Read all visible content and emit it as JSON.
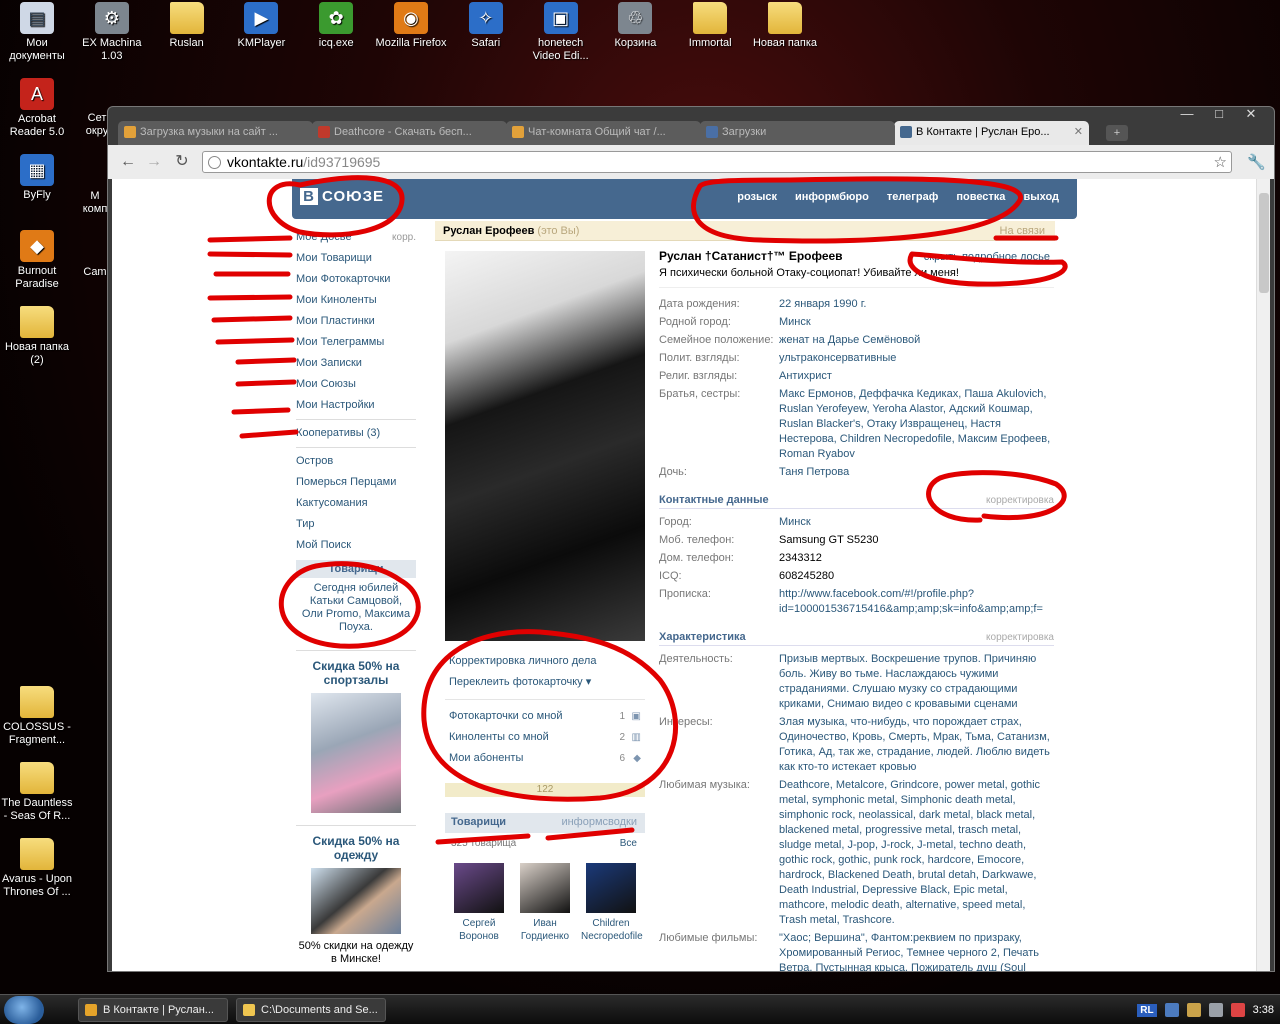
{
  "desktop": {
    "icons_top": [
      {
        "label": "Мои документы",
        "glyph": "▤",
        "kind": "g-doc"
      },
      {
        "label": "EX Machina 1.03",
        "glyph": "⚙",
        "kind": "g-gray"
      },
      {
        "label": "Ruslan",
        "glyph": "",
        "kind": "g-folder"
      },
      {
        "label": "KMPlayer",
        "glyph": "▶",
        "kind": "g-blue"
      },
      {
        "label": "icq.exe",
        "glyph": "✿",
        "kind": "g-green"
      },
      {
        "label": "Mozilla Firefox",
        "glyph": "◉",
        "kind": "g-orange"
      },
      {
        "label": "Safari",
        "glyph": "✧",
        "kind": "g-blue"
      },
      {
        "label": "honetech Video Edi...",
        "glyph": "▣",
        "kind": "g-blue"
      },
      {
        "label": "Корзина",
        "glyph": "♲",
        "kind": "g-gray"
      },
      {
        "label": "Immortal",
        "glyph": "",
        "kind": "g-folder"
      },
      {
        "label": "Новая папка",
        "glyph": "",
        "kind": "g-folder"
      }
    ],
    "icons_left": [
      {
        "label": "Acrobat Reader 5.0",
        "glyph": "A",
        "kind": "g-red"
      },
      {
        "label": "ByFly",
        "glyph": "▦",
        "kind": "g-blue"
      },
      {
        "label": "Burnout Paradise",
        "glyph": "◆",
        "kind": "g-orange"
      },
      {
        "label": "Новая папка (2)",
        "glyph": "",
        "kind": "g-folder"
      },
      {
        "label": "COLOSSUS - Fragment...",
        "glyph": "",
        "kind": "g-folder"
      },
      {
        "label": "The Dauntless - Seas Of R...",
        "glyph": "",
        "kind": "g-folder"
      },
      {
        "label": "Avarus - Upon Thrones Of ...",
        "glyph": "",
        "kind": "g-folder"
      }
    ],
    "partial_labels": [
      "Сет окру",
      "М комп",
      "Cam"
    ]
  },
  "browser": {
    "tabs": [
      {
        "title": "Загрузка музыки на сайт ...",
        "color": "#e2a13a"
      },
      {
        "title": "Deathcore - Скачать бесп...",
        "color": "#c0392b"
      },
      {
        "title": "Чат-комната Общий чат /...",
        "color": "#e2a13a"
      },
      {
        "title": "Загрузки",
        "color": "#4a6fa5"
      },
      {
        "title": "В Контакте | Руслан Еро...",
        "color": "#45688e"
      }
    ],
    "url_host": "vkontakte.ru",
    "url_path": "/id93719695",
    "controls": {
      "min": "—",
      "max": "□",
      "close": "✕"
    }
  },
  "vk": {
    "logo_b": "В",
    "logo_text": "СОЮЗЕ",
    "nav": [
      "розыск",
      "информбюро",
      "телеграф",
      "повестка",
      "выход"
    ],
    "menu": [
      "Моё Досье",
      "Мои Товарищи",
      "Мои Фотокарточки",
      "Мои Киноленты",
      "Мои Пластинки",
      "Мои Телеграммы",
      "Мои Записки",
      "Мои Союзы",
      "Мои Настройки"
    ],
    "menu_edit": "корр.",
    "coops": "Кооперативы (3)",
    "menu2": [
      "Остров",
      "Померься Перцами",
      "Кактусомания",
      "Тир",
      "Мой Поиск"
    ],
    "friends_box_title": "Товарищи",
    "friends_box_text": "Сегодня юбилей Катьки Самцовой, Оли Promo, Максима Поуха.",
    "ad1_title": "Скидка 50% на спортзалы",
    "ad2_title": "Скидка 50% на одежду",
    "ad2_caption": "50% скидки на одежду в Минске!",
    "head_name": "Руслан Ерофеев",
    "head_me": "(это Вы)",
    "head_online": "На связи",
    "profile_name": "Руслан †Сатанист†™ Ерофеев",
    "hide_link": "скрыть подробное досье",
    "status": "Я психически больной Отаку-социопат! Убивайте ли меня!",
    "basic": [
      {
        "k": "Дата рождения:",
        "v": "22 января 1990 г."
      },
      {
        "k": "Родной город:",
        "v": "Минск"
      },
      {
        "k": "Семейное положение:",
        "v": "женат на Дарье Семёновой"
      },
      {
        "k": "Полит. взгляды:",
        "v": "ультраконсервативные"
      },
      {
        "k": "Религ. взгляды:",
        "v": "Антихрист"
      },
      {
        "k": "Братья, сестры:",
        "v": "Макс Ермонов, Деффачка Кедиках, Паша Akulovich, Ruslan Yerofeyew, Yeroha Alastor, Адский Кошмар, Ruslan Blacker's, Отаку Извращенец, Настя Нестерова, Children Necropedofile, Максим Ерофеев, Roman Ryabov"
      },
      {
        "k": "Дочь:",
        "v": "Таня Петрова"
      }
    ],
    "contacts_title": "Контактные данные",
    "edit_label": "корректировка",
    "contacts": [
      {
        "k": "Город:",
        "v": "Минск"
      },
      {
        "k": "Моб. телефон:",
        "v": "Samsung GT S5230"
      },
      {
        "k": "Дом. телефон:",
        "v": "2343312"
      },
      {
        "k": "ICQ:",
        "v": "608245280"
      },
      {
        "k": "Прописка:",
        "v": "http://www.facebook.com/#!/profile.php?id=100001536715416&amp;amp;sk=info&amp;amp;f="
      }
    ],
    "traits_title": "Характеристика",
    "traits": [
      {
        "k": "Деятельность:",
        "v": "Призыв мертвых. Воскрешение трупов. Причиняю боль. Живу во тьме. Наслаждаюсь чужими страданиями. Слушаю музку со страдающими криками, Снимаю видео с кровавыми сценами"
      },
      {
        "k": "Интересы:",
        "v": "Злая музыка, что-нибудь, что порождает страх, Одиночество, Кровь, Смерть, Мрак, Тьма, Сатанизм, Готика, Ад, так же, страдание, людей. Люблю видеть как кто-то истекает кровью"
      },
      {
        "k": "Любимая музыка:",
        "v": "Deathcore, Metalcore, Grindcore, power metal, gothic metal, symphonic metal, Simphonic death metal, simphonic rock, neolassical, dark metal, black metal, blackened metal, progressive metal, trasch metal, sludge metal, J-pop, J-rock, J-metal, techno death, gothic rock, gothic, punk rock, hardcore, Emocore, hardrock, Blackened Death, brutal detah, Darkwawe, Death Industrial, Depressive Black, Epic metal, mathcore, melodic death, alternative, speed metal, Trash metal, Trashcore."
      },
      {
        "k": "Любимые фильмы:",
        "v": "\"Хаос; Вершина\", Фантом:реквием по призраку, Хромированный Региос, Темнее черного 2, Печать Ветра, Пустынная крыса, Пожиратель душ (Soul"
      }
    ],
    "photo_actions": [
      "Корректировка личного дела",
      "Переклеить фотокарточку ▾"
    ],
    "photo_links": [
      {
        "label": "Фотокарточки со мной",
        "count": "1",
        "icon": "camera-icon",
        "glyph": "▣"
      },
      {
        "label": "Киноленты со мной",
        "count": "2",
        "icon": "film-icon",
        "glyph": "▥"
      },
      {
        "label": "Мои абоненты",
        "count": "6",
        "icon": "people-icon",
        "glyph": "◆"
      }
    ],
    "rating": "122",
    "friends_tab": "Товарищи",
    "friends_tab_right": "информсводки",
    "friends_count": "325 товарища",
    "friends_all": "Все",
    "friends": [
      {
        "name": "Сергей Воронов",
        "color": "#6a4a8a"
      },
      {
        "name": "Иван Гордиенко",
        "color": "#d9d0c8"
      },
      {
        "name": "Children Necropedofile",
        "color": "#1b3a7a"
      }
    ]
  },
  "taskbar": {
    "tasks": [
      {
        "label": "В Контакте | Руслан...",
        "color": "#e4a32a"
      },
      {
        "label": "C:\\Documents and Se...",
        "color": "#f0c650"
      }
    ],
    "lang": "RL",
    "time": "3:38"
  },
  "colors": {
    "vk_blue": "#45688e",
    "link": "#2b587a",
    "marker": "#e00000"
  }
}
